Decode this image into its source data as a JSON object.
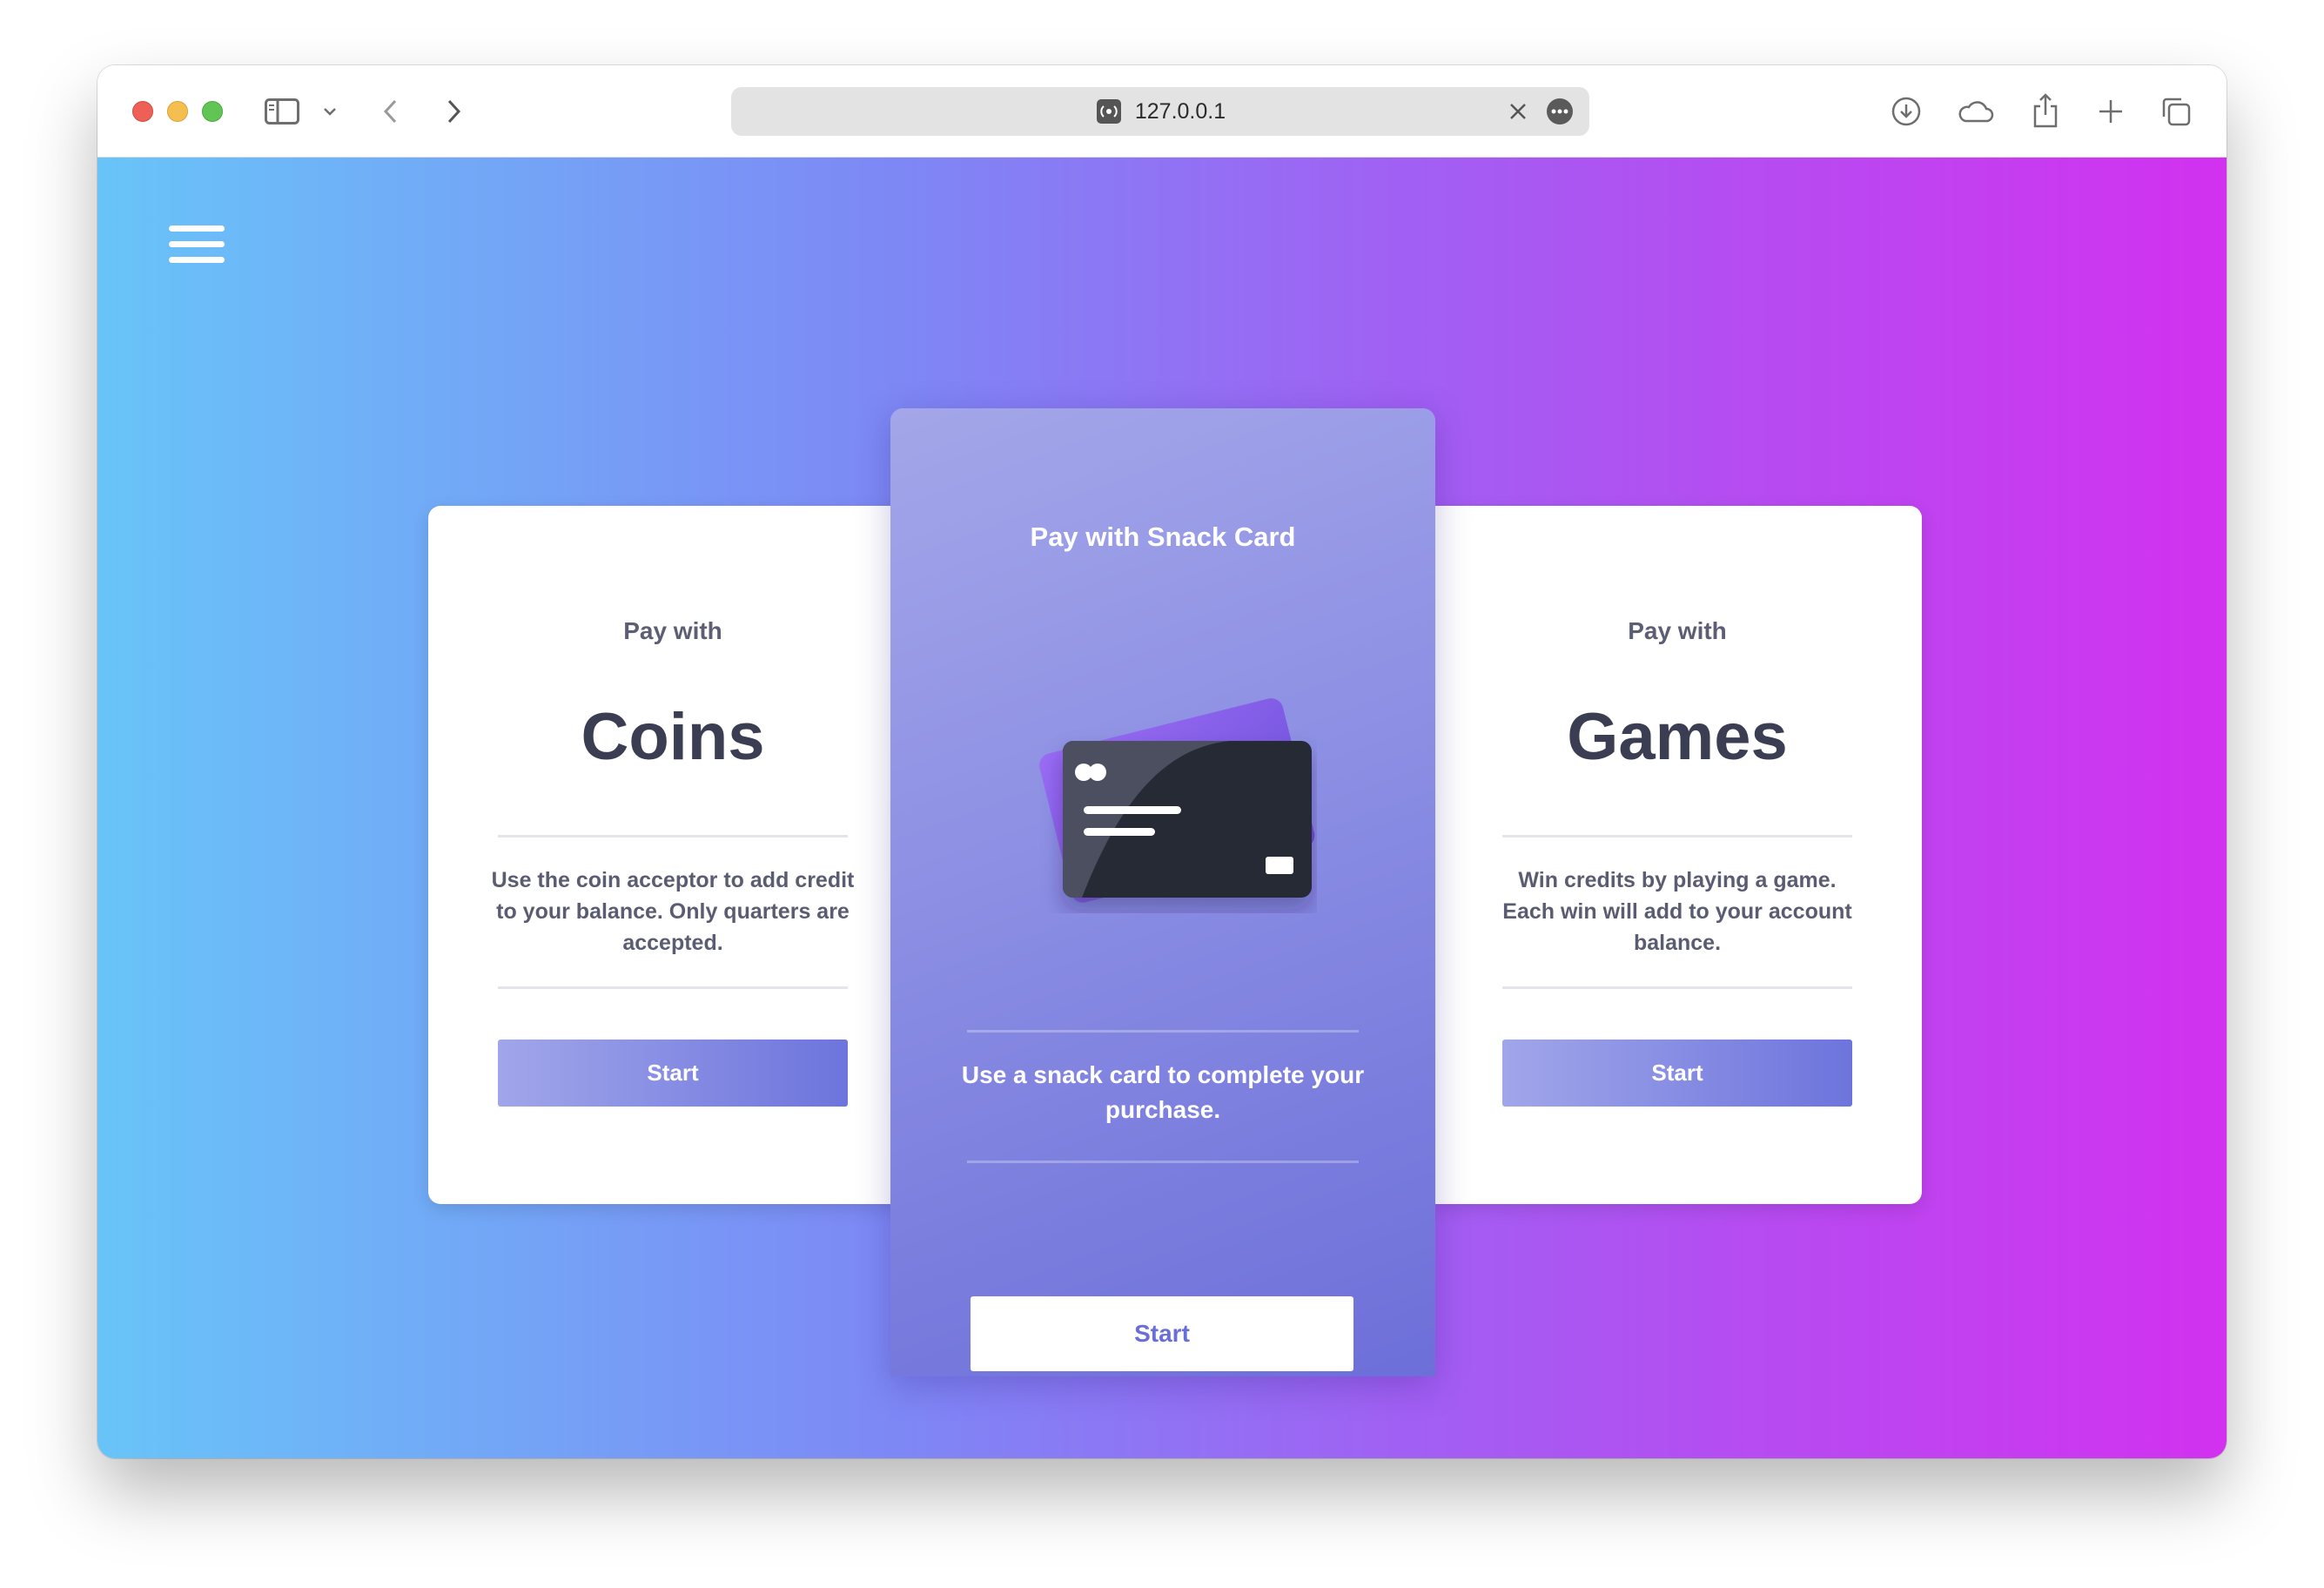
{
  "browser": {
    "url": "127.0.0.1",
    "icons": [
      "sidebar-icon",
      "chevron-down-icon",
      "back-icon",
      "forward-icon",
      "site-icon",
      "clear-icon",
      "more-icon",
      "download-icon",
      "cloud-icon",
      "share-icon",
      "new-tab-icon",
      "tabs-overview-icon"
    ]
  },
  "colors": {
    "gradient_start": "#68c4f8",
    "gradient_mid": "#7e87f5",
    "gradient_end": "#d231ef",
    "button_accent": "#6d74dc"
  },
  "options": {
    "coins": {
      "pay_with": "Pay with",
      "method": "Coins",
      "description": "Use the coin acceptor to add credit to your balance. Only quarters are accepted.",
      "start": "Start"
    },
    "snack_card": {
      "title": "Pay with Snack Card",
      "description": "Use a snack card to complete your purchase.",
      "start": "Start"
    },
    "games": {
      "pay_with": "Pay with",
      "method": "Games",
      "description": "Win credits by playing a game. Each win will add to your account balance.",
      "start": "Start"
    }
  }
}
